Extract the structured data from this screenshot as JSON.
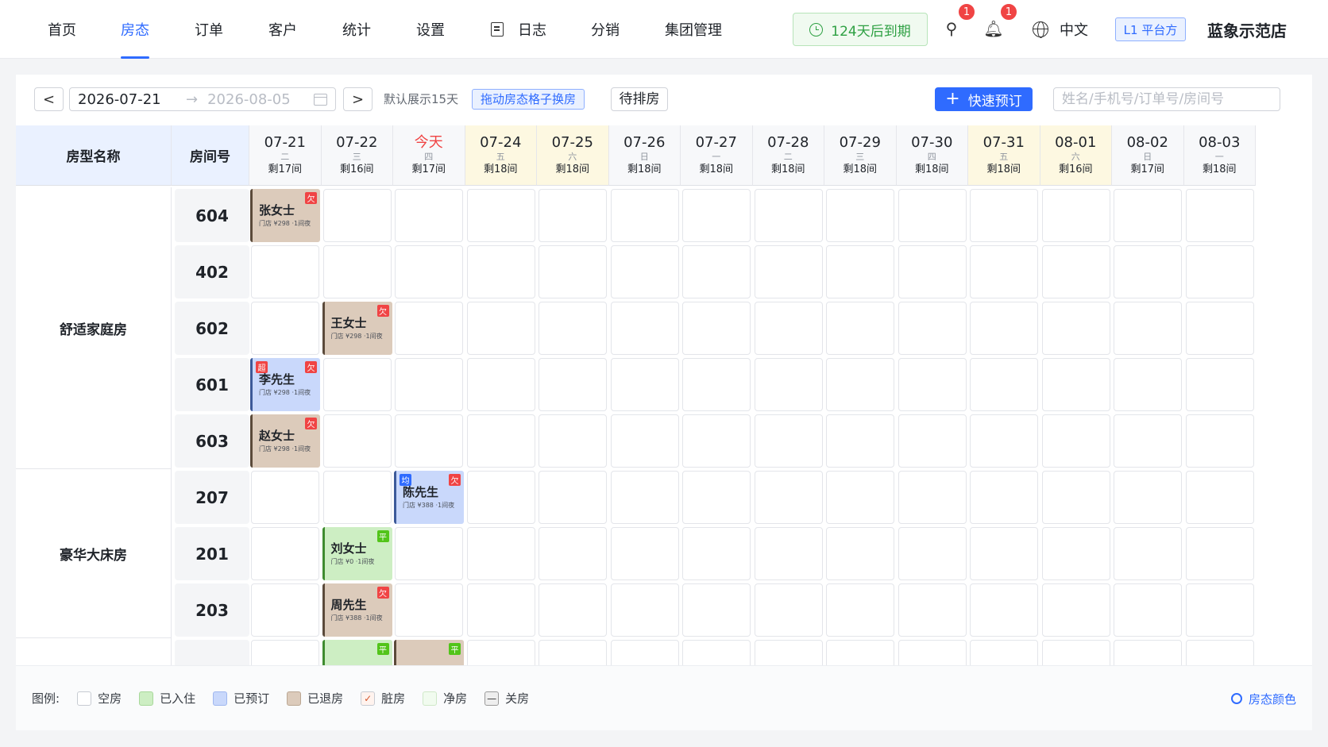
{
  "nav": {
    "items": [
      "首页",
      "房态",
      "订单",
      "客户",
      "统计",
      "设置",
      "日志",
      "分销",
      "集团管理"
    ],
    "active": "房态",
    "expiry": "124天后到期",
    "tools_badge": "1",
    "bell_badge": "1",
    "language": "中文",
    "platform": "L1 平台方",
    "store": "蓝象示范店"
  },
  "toolbar": {
    "prev": "<",
    "next": ">",
    "start_date": "2026-07-21",
    "end_date": "2026-08-05",
    "hint": "默认展示15天",
    "drag_tip": "拖动房态格子换房",
    "pending": "待排房",
    "quick_book": "快速预订",
    "search_placeholder": "姓名/手机号/订单号/房间号"
  },
  "grid": {
    "col_type": "房型名称",
    "col_room": "房间号",
    "days": [
      {
        "date": "07-21",
        "week": "二",
        "left": "剩17间",
        "weekend": false
      },
      {
        "date": "07-22",
        "week": "三",
        "left": "剩16间",
        "weekend": false
      },
      {
        "date": "今天",
        "week": "四",
        "left": "剩17间",
        "weekend": false,
        "today": true
      },
      {
        "date": "07-24",
        "week": "五",
        "left": "剩18间",
        "weekend": true
      },
      {
        "date": "07-25",
        "week": "六",
        "left": "剩18间",
        "weekend": true
      },
      {
        "date": "07-26",
        "week": "日",
        "left": "剩18间",
        "weekend": false
      },
      {
        "date": "07-27",
        "week": "一",
        "left": "剩18间",
        "weekend": false
      },
      {
        "date": "07-28",
        "week": "二",
        "left": "剩18间",
        "weekend": false
      },
      {
        "date": "07-29",
        "week": "三",
        "left": "剩18间",
        "weekend": false
      },
      {
        "date": "07-30",
        "week": "四",
        "left": "剩18间",
        "weekend": false
      },
      {
        "date": "07-31",
        "week": "五",
        "left": "剩18间",
        "weekend": true
      },
      {
        "date": "08-01",
        "week": "六",
        "left": "剩16间",
        "weekend": true
      },
      {
        "date": "08-02",
        "week": "日",
        "left": "剩17间",
        "weekend": false
      },
      {
        "date": "08-03",
        "week": "一",
        "left": "剩18间",
        "weekend": false
      }
    ],
    "groups": [
      {
        "name": "舒适家庭房",
        "rooms": [
          "604",
          "402",
          "602",
          "601",
          "603"
        ]
      },
      {
        "name": "豪华大床房",
        "rooms": [
          "207",
          "201",
          "203"
        ]
      },
      {
        "name": "",
        "rooms": [
          ""
        ]
      }
    ],
    "bookings": [
      {
        "room_index": 0,
        "day": 0,
        "name": "张女士",
        "sub": "门店 ¥298 ·1间夜",
        "status": "checked-out",
        "right_tag": "欠",
        "left_tag": ""
      },
      {
        "room_index": 2,
        "day": 1,
        "name": "王女士",
        "sub": "门店 ¥298 ·1间夜",
        "status": "checked-out",
        "right_tag": "欠",
        "left_tag": ""
      },
      {
        "room_index": 3,
        "day": 0,
        "name": "李先生",
        "sub": "门店 ¥298 ·1间夜",
        "status": "booked",
        "right_tag": "欠",
        "left_tag": "超"
      },
      {
        "room_index": 4,
        "day": 0,
        "name": "赵女士",
        "sub": "门店 ¥298 ·1间夜",
        "status": "checked-out",
        "right_tag": "欠",
        "left_tag": ""
      },
      {
        "room_index": 5,
        "day": 2,
        "name": "陈先生",
        "sub": "门店 ¥388 ·1间夜",
        "status": "booked",
        "right_tag": "欠",
        "left_tag": "均"
      },
      {
        "room_index": 6,
        "day": 1,
        "name": "刘女士",
        "sub": "门店 ¥0 ·1间夜",
        "status": "checked-in",
        "right_tag": "平",
        "left_tag": ""
      },
      {
        "room_index": 7,
        "day": 1,
        "name": "周先生",
        "sub": "门店 ¥388 ·1间夜",
        "status": "checked-out",
        "right_tag": "欠",
        "left_tag": ""
      },
      {
        "room_index": 8,
        "day": 1,
        "name": "",
        "sub": "",
        "status": "checked-in",
        "right_tag": "平",
        "left_tag": ""
      },
      {
        "room_index": 8,
        "day": 2,
        "name": "",
        "sub": "",
        "status": "checked-out",
        "right_tag": "平",
        "left_tag": ""
      }
    ]
  },
  "legend": {
    "title": "图例:",
    "items": [
      {
        "label": "空房",
        "color": "#ffffff",
        "border": "#c7cbd2"
      },
      {
        "label": "已入住",
        "color": "#cdeec3",
        "border": "#a8d89a"
      },
      {
        "label": "已预订",
        "color": "#c9d8fb",
        "border": "#9fb7ef"
      },
      {
        "label": "已退房",
        "color": "#dccbbb",
        "border": "#bba793"
      },
      {
        "label": "脏房",
        "color": "#fff3ee",
        "border": "#c7cbd2",
        "glyph": "✓"
      },
      {
        "label": "净房",
        "color": "#f1fbef",
        "border": "#cfe8c8"
      },
      {
        "label": "关房",
        "color": "#eeeeee",
        "border": "#9a9a9a",
        "glyph": "—"
      }
    ],
    "room_color": "房态颜色"
  }
}
